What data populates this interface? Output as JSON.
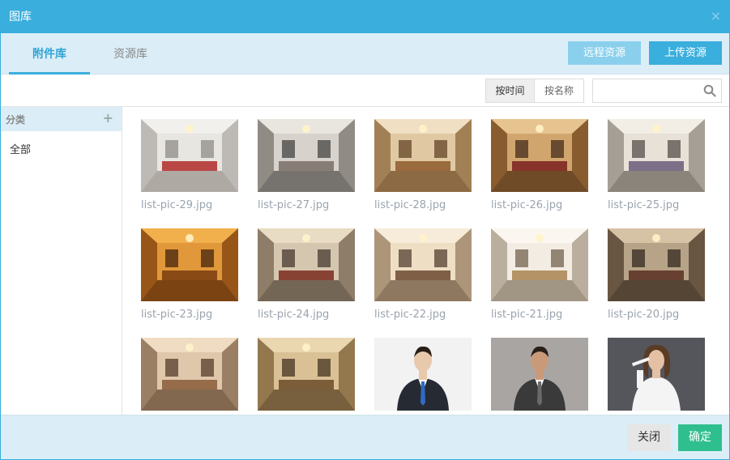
{
  "dialog": {
    "title": "图库",
    "close_glyph": "×"
  },
  "tabs": [
    {
      "label": "附件库",
      "active": true
    },
    {
      "label": "资源库",
      "active": false
    }
  ],
  "actions": {
    "remote_label": "远程资源",
    "upload_label": "上传资源"
  },
  "toolbar": {
    "sort_by_time": "按时间",
    "sort_by_name": "按名称",
    "search_value": "",
    "search_placeholder": "",
    "search_icon": "search-icon"
  },
  "sidebar": {
    "header": "分类",
    "add_glyph": "+",
    "items": [
      {
        "label": "全部"
      }
    ]
  },
  "gallery": {
    "items": [
      {
        "caption": "list-pic-29.jpg",
        "theme": "white-living"
      },
      {
        "caption": "list-pic-27.jpg",
        "theme": "gray-living"
      },
      {
        "caption": "list-pic-28.jpg",
        "theme": "warm-dining"
      },
      {
        "caption": "list-pic-26.jpg",
        "theme": "amber-dining"
      },
      {
        "caption": "list-pic-25.jpg",
        "theme": "cream-living"
      },
      {
        "caption": "list-pic-23.jpg",
        "theme": "orange-bedroom"
      },
      {
        "caption": "list-pic-24.jpg",
        "theme": "chandelier-living"
      },
      {
        "caption": "list-pic-22.jpg",
        "theme": "bright-dining"
      },
      {
        "caption": "list-pic-21.jpg",
        "theme": "white-hall"
      },
      {
        "caption": "list-pic-20.jpg",
        "theme": "dark-living"
      },
      {
        "caption": "",
        "theme": "tan-bedroom"
      },
      {
        "caption": "",
        "theme": "gold-hall"
      },
      {
        "caption": "",
        "theme": "man-suit-blue-tie"
      },
      {
        "caption": "",
        "theme": "man-casual-gray"
      },
      {
        "caption": "",
        "theme": "woman-white-shirt"
      }
    ]
  },
  "footer": {
    "close_label": "关闭",
    "ok_label": "确定"
  },
  "colors": {
    "accent": "#3aaedc",
    "panel": "#dbeef7",
    "ok": "#2fbf8f",
    "muted_button": "#8ad0ed"
  }
}
